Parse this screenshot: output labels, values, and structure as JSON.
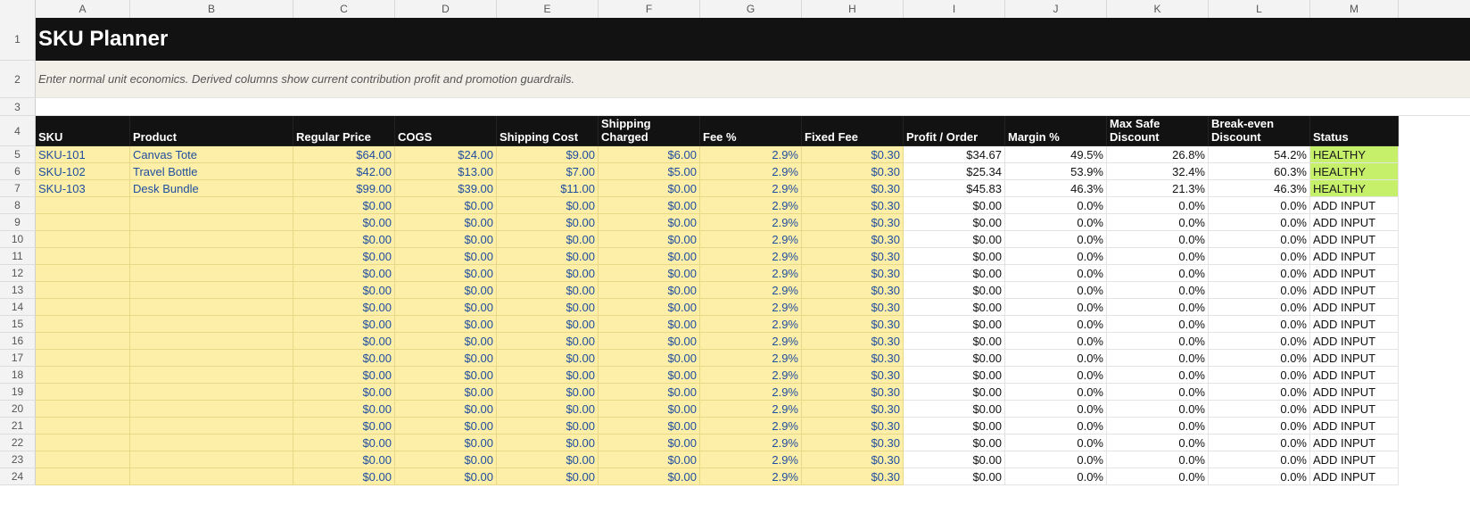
{
  "columns": [
    "A",
    "B",
    "C",
    "D",
    "E",
    "F",
    "G",
    "H",
    "I",
    "J",
    "K",
    "L",
    "M"
  ],
  "title": "SKU Planner",
  "subtitle": "Enter normal unit economics. Derived columns show current contribution profit and promotion guardrails.",
  "headers": [
    "SKU",
    "Product",
    "Regular Price",
    "COGS",
    "Shipping Cost",
    "Shipping Charged",
    "Fee %",
    "Fixed Fee",
    "Profit / Order",
    "Margin %",
    "Max Safe Discount",
    "Break-even Discount",
    "Status"
  ],
  "rows": [
    {
      "n": "5",
      "sku": "SKU-101",
      "product": "Canvas Tote",
      "price": "$64.00",
      "cogs": "$24.00",
      "ship_cost": "$9.00",
      "ship_charged": "$6.00",
      "fee_pct": "2.9%",
      "fixed_fee": "$0.30",
      "profit": "$34.67",
      "margin": "49.5%",
      "max_discount": "26.8%",
      "breakeven": "54.2%",
      "status": "HEALTHY"
    },
    {
      "n": "6",
      "sku": "SKU-102",
      "product": "Travel Bottle",
      "price": "$42.00",
      "cogs": "$13.00",
      "ship_cost": "$7.00",
      "ship_charged": "$5.00",
      "fee_pct": "2.9%",
      "fixed_fee": "$0.30",
      "profit": "$25.34",
      "margin": "53.9%",
      "max_discount": "32.4%",
      "breakeven": "60.3%",
      "status": "HEALTHY"
    },
    {
      "n": "7",
      "sku": "SKU-103",
      "product": "Desk Bundle",
      "price": "$99.00",
      "cogs": "$39.00",
      "ship_cost": "$11.00",
      "ship_charged": "$0.00",
      "fee_pct": "2.9%",
      "fixed_fee": "$0.30",
      "profit": "$45.83",
      "margin": "46.3%",
      "max_discount": "21.3%",
      "breakeven": "46.3%",
      "status": "HEALTHY"
    },
    {
      "n": "8",
      "sku": "",
      "product": "",
      "price": "$0.00",
      "cogs": "$0.00",
      "ship_cost": "$0.00",
      "ship_charged": "$0.00",
      "fee_pct": "2.9%",
      "fixed_fee": "$0.30",
      "profit": "$0.00",
      "margin": "0.0%",
      "max_discount": "0.0%",
      "breakeven": "0.0%",
      "status": "ADD INPUT"
    },
    {
      "n": "9",
      "sku": "",
      "product": "",
      "price": "$0.00",
      "cogs": "$0.00",
      "ship_cost": "$0.00",
      "ship_charged": "$0.00",
      "fee_pct": "2.9%",
      "fixed_fee": "$0.30",
      "profit": "$0.00",
      "margin": "0.0%",
      "max_discount": "0.0%",
      "breakeven": "0.0%",
      "status": "ADD INPUT"
    },
    {
      "n": "10",
      "sku": "",
      "product": "",
      "price": "$0.00",
      "cogs": "$0.00",
      "ship_cost": "$0.00",
      "ship_charged": "$0.00",
      "fee_pct": "2.9%",
      "fixed_fee": "$0.30",
      "profit": "$0.00",
      "margin": "0.0%",
      "max_discount": "0.0%",
      "breakeven": "0.0%",
      "status": "ADD INPUT"
    },
    {
      "n": "11",
      "sku": "",
      "product": "",
      "price": "$0.00",
      "cogs": "$0.00",
      "ship_cost": "$0.00",
      "ship_charged": "$0.00",
      "fee_pct": "2.9%",
      "fixed_fee": "$0.30",
      "profit": "$0.00",
      "margin": "0.0%",
      "max_discount": "0.0%",
      "breakeven": "0.0%",
      "status": "ADD INPUT"
    },
    {
      "n": "12",
      "sku": "",
      "product": "",
      "price": "$0.00",
      "cogs": "$0.00",
      "ship_cost": "$0.00",
      "ship_charged": "$0.00",
      "fee_pct": "2.9%",
      "fixed_fee": "$0.30",
      "profit": "$0.00",
      "margin": "0.0%",
      "max_discount": "0.0%",
      "breakeven": "0.0%",
      "status": "ADD INPUT"
    },
    {
      "n": "13",
      "sku": "",
      "product": "",
      "price": "$0.00",
      "cogs": "$0.00",
      "ship_cost": "$0.00",
      "ship_charged": "$0.00",
      "fee_pct": "2.9%",
      "fixed_fee": "$0.30",
      "profit": "$0.00",
      "margin": "0.0%",
      "max_discount": "0.0%",
      "breakeven": "0.0%",
      "status": "ADD INPUT"
    },
    {
      "n": "14",
      "sku": "",
      "product": "",
      "price": "$0.00",
      "cogs": "$0.00",
      "ship_cost": "$0.00",
      "ship_charged": "$0.00",
      "fee_pct": "2.9%",
      "fixed_fee": "$0.30",
      "profit": "$0.00",
      "margin": "0.0%",
      "max_discount": "0.0%",
      "breakeven": "0.0%",
      "status": "ADD INPUT"
    },
    {
      "n": "15",
      "sku": "",
      "product": "",
      "price": "$0.00",
      "cogs": "$0.00",
      "ship_cost": "$0.00",
      "ship_charged": "$0.00",
      "fee_pct": "2.9%",
      "fixed_fee": "$0.30",
      "profit": "$0.00",
      "margin": "0.0%",
      "max_discount": "0.0%",
      "breakeven": "0.0%",
      "status": "ADD INPUT"
    },
    {
      "n": "16",
      "sku": "",
      "product": "",
      "price": "$0.00",
      "cogs": "$0.00",
      "ship_cost": "$0.00",
      "ship_charged": "$0.00",
      "fee_pct": "2.9%",
      "fixed_fee": "$0.30",
      "profit": "$0.00",
      "margin": "0.0%",
      "max_discount": "0.0%",
      "breakeven": "0.0%",
      "status": "ADD INPUT"
    },
    {
      "n": "17",
      "sku": "",
      "product": "",
      "price": "$0.00",
      "cogs": "$0.00",
      "ship_cost": "$0.00",
      "ship_charged": "$0.00",
      "fee_pct": "2.9%",
      "fixed_fee": "$0.30",
      "profit": "$0.00",
      "margin": "0.0%",
      "max_discount": "0.0%",
      "breakeven": "0.0%",
      "status": "ADD INPUT"
    },
    {
      "n": "18",
      "sku": "",
      "product": "",
      "price": "$0.00",
      "cogs": "$0.00",
      "ship_cost": "$0.00",
      "ship_charged": "$0.00",
      "fee_pct": "2.9%",
      "fixed_fee": "$0.30",
      "profit": "$0.00",
      "margin": "0.0%",
      "max_discount": "0.0%",
      "breakeven": "0.0%",
      "status": "ADD INPUT"
    },
    {
      "n": "19",
      "sku": "",
      "product": "",
      "price": "$0.00",
      "cogs": "$0.00",
      "ship_cost": "$0.00",
      "ship_charged": "$0.00",
      "fee_pct": "2.9%",
      "fixed_fee": "$0.30",
      "profit": "$0.00",
      "margin": "0.0%",
      "max_discount": "0.0%",
      "breakeven": "0.0%",
      "status": "ADD INPUT"
    },
    {
      "n": "20",
      "sku": "",
      "product": "",
      "price": "$0.00",
      "cogs": "$0.00",
      "ship_cost": "$0.00",
      "ship_charged": "$0.00",
      "fee_pct": "2.9%",
      "fixed_fee": "$0.30",
      "profit": "$0.00",
      "margin": "0.0%",
      "max_discount": "0.0%",
      "breakeven": "0.0%",
      "status": "ADD INPUT"
    },
    {
      "n": "21",
      "sku": "",
      "product": "",
      "price": "$0.00",
      "cogs": "$0.00",
      "ship_cost": "$0.00",
      "ship_charged": "$0.00",
      "fee_pct": "2.9%",
      "fixed_fee": "$0.30",
      "profit": "$0.00",
      "margin": "0.0%",
      "max_discount": "0.0%",
      "breakeven": "0.0%",
      "status": "ADD INPUT"
    },
    {
      "n": "22",
      "sku": "",
      "product": "",
      "price": "$0.00",
      "cogs": "$0.00",
      "ship_cost": "$0.00",
      "ship_charged": "$0.00",
      "fee_pct": "2.9%",
      "fixed_fee": "$0.30",
      "profit": "$0.00",
      "margin": "0.0%",
      "max_discount": "0.0%",
      "breakeven": "0.0%",
      "status": "ADD INPUT"
    },
    {
      "n": "23",
      "sku": "",
      "product": "",
      "price": "$0.00",
      "cogs": "$0.00",
      "ship_cost": "$0.00",
      "ship_charged": "$0.00",
      "fee_pct": "2.9%",
      "fixed_fee": "$0.30",
      "profit": "$0.00",
      "margin": "0.0%",
      "max_discount": "0.0%",
      "breakeven": "0.0%",
      "status": "ADD INPUT"
    },
    {
      "n": "24",
      "sku": "",
      "product": "",
      "price": "$0.00",
      "cogs": "$0.00",
      "ship_cost": "$0.00",
      "ship_charged": "$0.00",
      "fee_pct": "2.9%",
      "fixed_fee": "$0.30",
      "profit": "$0.00",
      "margin": "0.0%",
      "max_discount": "0.0%",
      "breakeven": "0.0%",
      "status": "ADD INPUT"
    }
  ],
  "colors": {
    "title_band": "#121212",
    "subtitle_band": "#f1efe8",
    "input_fill": "#fdeea8",
    "input_text": "#1f4e9e",
    "healthy_fill": "#c6ef6a"
  }
}
